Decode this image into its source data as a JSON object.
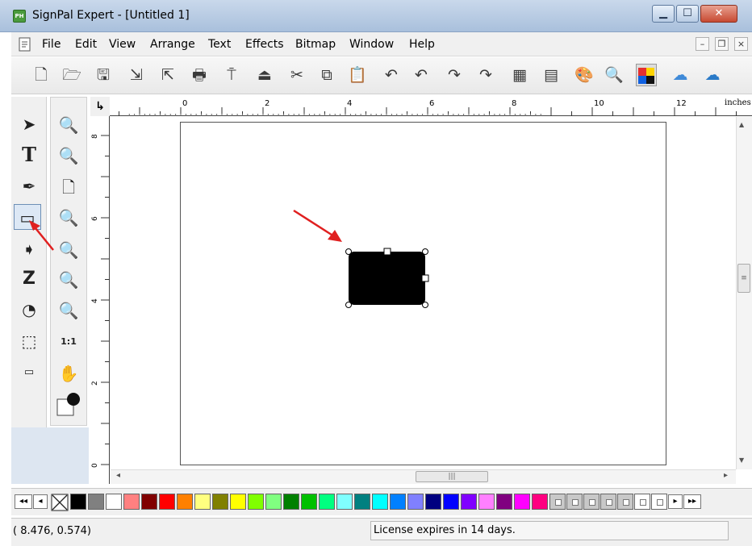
{
  "window": {
    "title": "SignPal Expert - [Untitled 1]",
    "app_icon": "PH",
    "min_glyph": "▁",
    "max_glyph": "☐",
    "close_glyph": "✕"
  },
  "menu": {
    "items": [
      "File",
      "Edit",
      "View",
      "Arrange",
      "Text",
      "Effects",
      "Bitmap",
      "Window",
      "Help"
    ],
    "mdi_min": "–",
    "mdi_restore": "❐",
    "mdi_close": "×"
  },
  "toolbar": {
    "buttons": [
      {
        "name": "new-icon",
        "glyph": "🗋"
      },
      {
        "name": "open-icon",
        "glyph": "🗁"
      },
      {
        "name": "save-icon",
        "glyph": "🖫"
      },
      {
        "name": "import-icon",
        "glyph": "⇲"
      },
      {
        "name": "export-icon",
        "glyph": "⇱"
      },
      {
        "name": "print-icon",
        "glyph": "🖶"
      },
      {
        "name": "plot-icon",
        "glyph": "⍑"
      },
      {
        "name": "cut-plot-icon",
        "glyph": "⏏"
      },
      {
        "name": "cut-icon",
        "glyph": "✂"
      },
      {
        "name": "copy-icon",
        "glyph": "⧉"
      },
      {
        "name": "paste-icon",
        "glyph": "📋"
      },
      {
        "name": "undo-icon",
        "glyph": "↶"
      },
      {
        "name": "undo-list-icon",
        "glyph": "↶"
      },
      {
        "name": "redo-icon",
        "glyph": "↷"
      },
      {
        "name": "redo-list-icon",
        "glyph": "↷"
      },
      {
        "name": "coordinates-icon",
        "glyph": "▦"
      },
      {
        "name": "properties-icon",
        "glyph": "▤"
      },
      {
        "name": "color-palette-icon",
        "glyph": "🎨"
      },
      {
        "name": "color-drop-icon",
        "glyph": "🔍"
      },
      {
        "name": "color-grid-icon",
        "glyph": "▩"
      },
      {
        "name": "cloud-icon",
        "glyph": "☁"
      },
      {
        "name": "cloud-upload-icon",
        "glyph": "☁"
      }
    ]
  },
  "tools_left": [
    {
      "name": "select-tool-icon",
      "glyph": "➤"
    },
    {
      "name": "text-tool-icon",
      "glyph": "T"
    },
    {
      "name": "pen-tool-icon",
      "glyph": "✒"
    },
    {
      "name": "rectangle-tool-icon",
      "glyph": "▭"
    },
    {
      "name": "node-edit-tool-icon",
      "glyph": "➧"
    },
    {
      "name": "distort-tool-icon",
      "glyph": "Z"
    },
    {
      "name": "shape-tool-icon",
      "glyph": "◔"
    },
    {
      "name": "frame-tool-icon",
      "glyph": "⬚"
    },
    {
      "name": "ruler-tool-icon",
      "glyph": "▭"
    }
  ],
  "tools_right": [
    {
      "name": "zoom-previous-icon",
      "glyph": "🔍"
    },
    {
      "name": "zoom-in-icon",
      "glyph": "🔍"
    },
    {
      "name": "zoom-page-icon",
      "glyph": "🗋"
    },
    {
      "name": "zoom-out-icon",
      "glyph": "🔍"
    },
    {
      "name": "zoom-fit-icon",
      "glyph": "🔍"
    },
    {
      "name": "zoom-object-icon",
      "glyph": "🔍"
    },
    {
      "name": "zoom-color-icon",
      "glyph": "🔍"
    },
    {
      "name": "zoom-actual-icon",
      "glyph": "1:1"
    },
    {
      "name": "hand-pan-icon",
      "glyph": "✋"
    }
  ],
  "ruler": {
    "units": "inches",
    "h_labels": [
      "0",
      "2",
      "4",
      "6",
      "8",
      "10",
      "12"
    ],
    "v_labels": [
      "8",
      "6",
      "4",
      "2",
      "0"
    ],
    "corner_glyph": "↳"
  },
  "palette": {
    "nav_left": [
      "◂◂",
      "◂"
    ],
    "nav_right": [
      "▸",
      "▸▸"
    ],
    "colors": [
      "#000000",
      "#808080",
      "#ffffff",
      "#ff8080",
      "#800000",
      "#ff0000",
      "#ff8000",
      "#ffff80",
      "#808000",
      "#ffff00",
      "#80ff00",
      "#80ff80",
      "#008000",
      "#00c000",
      "#00ff80",
      "#80ffff",
      "#008080",
      "#00ffff",
      "#0080ff",
      "#8080ff",
      "#000080",
      "#0000ff",
      "#8000ff",
      "#ff80ff",
      "#800080",
      "#ff00ff",
      "#ff0080"
    ]
  },
  "scroll": {
    "grip": "|||",
    "up": "▲",
    "down": "▼",
    "left": "◂",
    "right": "▸",
    "v_grip": "≡"
  },
  "status": {
    "coords": "(    8.476,     0.574)",
    "license": "License expires in 14 days."
  },
  "accent_color": "#e02020"
}
